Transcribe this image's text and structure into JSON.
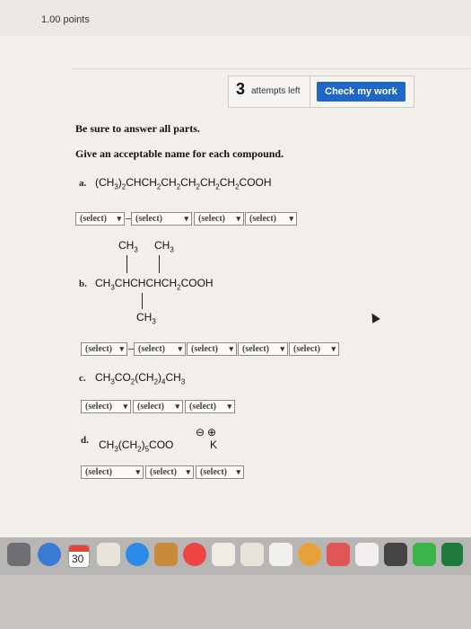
{
  "header": {
    "points": "1.00 points"
  },
  "attempts": {
    "count": "3",
    "label": "attempts left"
  },
  "check_button": {
    "label": "Check my work"
  },
  "instructions": {
    "line1": "Be sure to answer all parts.",
    "line2": "Give an acceptable name for each compound."
  },
  "select_label": "(select)",
  "questions": {
    "a": {
      "letter": "a.",
      "formula_parts": [
        "(CH",
        "3",
        ")",
        "2",
        "CHCH",
        "2",
        "CH",
        "2",
        "CH",
        "2",
        "CH",
        "2",
        "CH",
        "2",
        "COOH"
      ]
    },
    "b": {
      "letter": "b.",
      "top_left": "CH",
      "top_left_sub": "3",
      "top_right": "CH",
      "top_right_sub": "3",
      "main_parts": [
        "CH",
        "3",
        "CHCHCHCH",
        "2",
        "COOH"
      ],
      "bottom": "CH",
      "bottom_sub": "3"
    },
    "c": {
      "letter": "c.",
      "formula_parts": [
        "CH",
        "3",
        "CO",
        "2",
        "(CH",
        "2",
        ")",
        "4",
        "CH",
        "3"
      ]
    },
    "d": {
      "letter": "d.",
      "formula_parts": [
        "CH",
        "3",
        "(CH",
        "2",
        ")",
        "5",
        "COO"
      ],
      "minus": "⊖",
      "plus": "⊕",
      "cation": "K"
    }
  },
  "dock": {
    "calendar_day": "30"
  },
  "colors": {
    "accent": "#1f67c5"
  }
}
